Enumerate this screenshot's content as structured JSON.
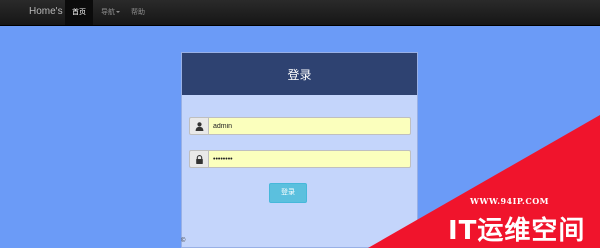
{
  "navbar": {
    "brand": "Home's",
    "items": [
      {
        "label": "首页",
        "active": true
      },
      {
        "label": "导航",
        "dropdown": true
      },
      {
        "label": "帮助"
      }
    ]
  },
  "login": {
    "title": "登录",
    "username": {
      "value": "admin",
      "icon": "user-icon"
    },
    "password": {
      "value": "wordpass",
      "icon": "lock-icon"
    },
    "submit_label": "登录"
  },
  "footer": {
    "copyright": "©"
  },
  "watermark": {
    "url": "WWW.94IP.COM",
    "name": "IT运维空间"
  },
  "colors": {
    "background": "#6b9bf7",
    "navbar": "#1f1f1f",
    "card_header": "#2e4271",
    "card_body": "#c4d5fb",
    "input_autofill": "#fbffbd",
    "button": "#5bc0de",
    "watermark": "#f0142c"
  }
}
